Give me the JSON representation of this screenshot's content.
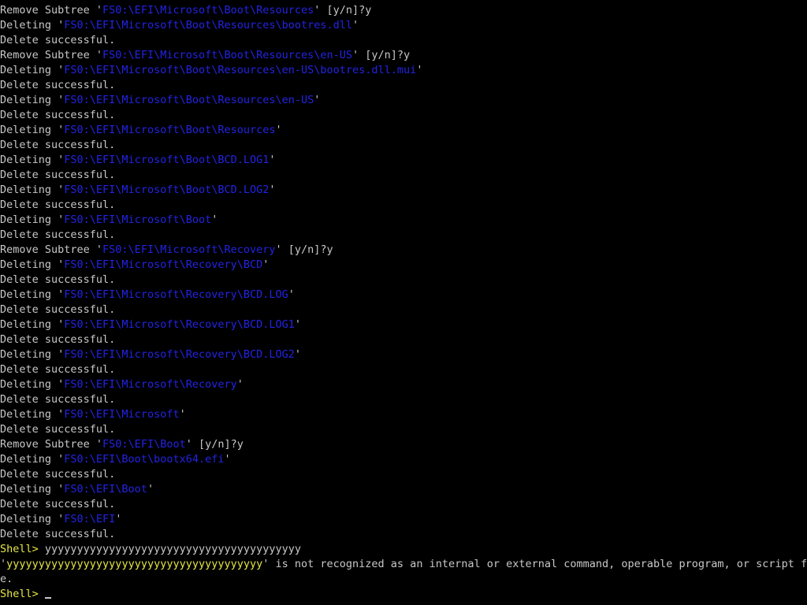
{
  "colors": {
    "background": "#000000",
    "text": "#c8c8c8",
    "path": "#2323e6",
    "prompt": "#e6e646"
  },
  "lines": [
    {
      "kind": "subtree",
      "prefix": "Remove Subtree '",
      "path": "FS0:\\EFI\\Microsoft\\Boot\\Resources",
      "suffix": "' [y/n]?y"
    },
    {
      "kind": "deleting",
      "prefix": "Deleting '",
      "path": "FS0:\\EFI\\Microsoft\\Boot\\Resources\\bootres.dll",
      "suffix": "'"
    },
    {
      "kind": "plain",
      "text": "Delete successful."
    },
    {
      "kind": "subtree",
      "prefix": "Remove Subtree '",
      "path": "FS0:\\EFI\\Microsoft\\Boot\\Resources\\en-US",
      "suffix": "' [y/n]?y"
    },
    {
      "kind": "deleting",
      "prefix": "Deleting '",
      "path": "FS0:\\EFI\\Microsoft\\Boot\\Resources\\en-US\\bootres.dll.mui",
      "suffix": "'"
    },
    {
      "kind": "plain",
      "text": "Delete successful."
    },
    {
      "kind": "deleting",
      "prefix": "Deleting '",
      "path": "FS0:\\EFI\\Microsoft\\Boot\\Resources\\en-US",
      "suffix": "'"
    },
    {
      "kind": "plain",
      "text": "Delete successful."
    },
    {
      "kind": "deleting",
      "prefix": "Deleting '",
      "path": "FS0:\\EFI\\Microsoft\\Boot\\Resources",
      "suffix": "'"
    },
    {
      "kind": "plain",
      "text": "Delete successful."
    },
    {
      "kind": "deleting",
      "prefix": "Deleting '",
      "path": "FS0:\\EFI\\Microsoft\\Boot\\BCD.LOG1",
      "suffix": "'"
    },
    {
      "kind": "plain",
      "text": "Delete successful."
    },
    {
      "kind": "deleting",
      "prefix": "Deleting '",
      "path": "FS0:\\EFI\\Microsoft\\Boot\\BCD.LOG2",
      "suffix": "'"
    },
    {
      "kind": "plain",
      "text": "Delete successful."
    },
    {
      "kind": "deleting",
      "prefix": "Deleting '",
      "path": "FS0:\\EFI\\Microsoft\\Boot",
      "suffix": "'"
    },
    {
      "kind": "plain",
      "text": "Delete successful."
    },
    {
      "kind": "subtree",
      "prefix": "Remove Subtree '",
      "path": "FS0:\\EFI\\Microsoft\\Recovery",
      "suffix": "' [y/n]?y"
    },
    {
      "kind": "deleting",
      "prefix": "Deleting '",
      "path": "FS0:\\EFI\\Microsoft\\Recovery\\BCD",
      "suffix": "'"
    },
    {
      "kind": "plain",
      "text": "Delete successful."
    },
    {
      "kind": "deleting",
      "prefix": "Deleting '",
      "path": "FS0:\\EFI\\Microsoft\\Recovery\\BCD.LOG",
      "suffix": "'"
    },
    {
      "kind": "plain",
      "text": "Delete successful."
    },
    {
      "kind": "deleting",
      "prefix": "Deleting '",
      "path": "FS0:\\EFI\\Microsoft\\Recovery\\BCD.LOG1",
      "suffix": "'"
    },
    {
      "kind": "plain",
      "text": "Delete successful."
    },
    {
      "kind": "deleting",
      "prefix": "Deleting '",
      "path": "FS0:\\EFI\\Microsoft\\Recovery\\BCD.LOG2",
      "suffix": "'"
    },
    {
      "kind": "plain",
      "text": "Delete successful."
    },
    {
      "kind": "deleting",
      "prefix": "Deleting '",
      "path": "FS0:\\EFI\\Microsoft\\Recovery",
      "suffix": "'"
    },
    {
      "kind": "plain",
      "text": "Delete successful."
    },
    {
      "kind": "deleting",
      "prefix": "Deleting '",
      "path": "FS0:\\EFI\\Microsoft",
      "suffix": "'"
    },
    {
      "kind": "plain",
      "text": "Delete successful."
    },
    {
      "kind": "subtree",
      "prefix": "Remove Subtree '",
      "path": "FS0:\\EFI\\Boot",
      "suffix": "' [y/n]?y"
    },
    {
      "kind": "deleting",
      "prefix": "Deleting '",
      "path": "FS0:\\EFI\\Boot\\bootx64.efi",
      "suffix": "'"
    },
    {
      "kind": "plain",
      "text": "Delete successful."
    },
    {
      "kind": "deleting",
      "prefix": "Deleting '",
      "path": "FS0:\\EFI\\Boot",
      "suffix": "'"
    },
    {
      "kind": "plain",
      "text": "Delete successful."
    },
    {
      "kind": "deleting",
      "prefix": "Deleting '",
      "path": "FS0:\\EFI",
      "suffix": "'"
    },
    {
      "kind": "plain",
      "text": "Delete successful."
    },
    {
      "kind": "prompt",
      "prompt": "Shell> ",
      "text": "yyyyyyyyyyyyyyyyyyyyyyyyyyyyyyyyyyyyyyyy"
    },
    {
      "kind": "error",
      "prefix": "'",
      "highlight": "yyyyyyyyyyyyyyyyyyyyyyyyyyyyyyyyyyyyyyyy",
      "suffix": "' is not recognized as an internal or external command, operable program, or script fil"
    },
    {
      "kind": "plain",
      "text": "e."
    },
    {
      "kind": "active_prompt",
      "prompt": "Shell> ",
      "text": ""
    }
  ]
}
